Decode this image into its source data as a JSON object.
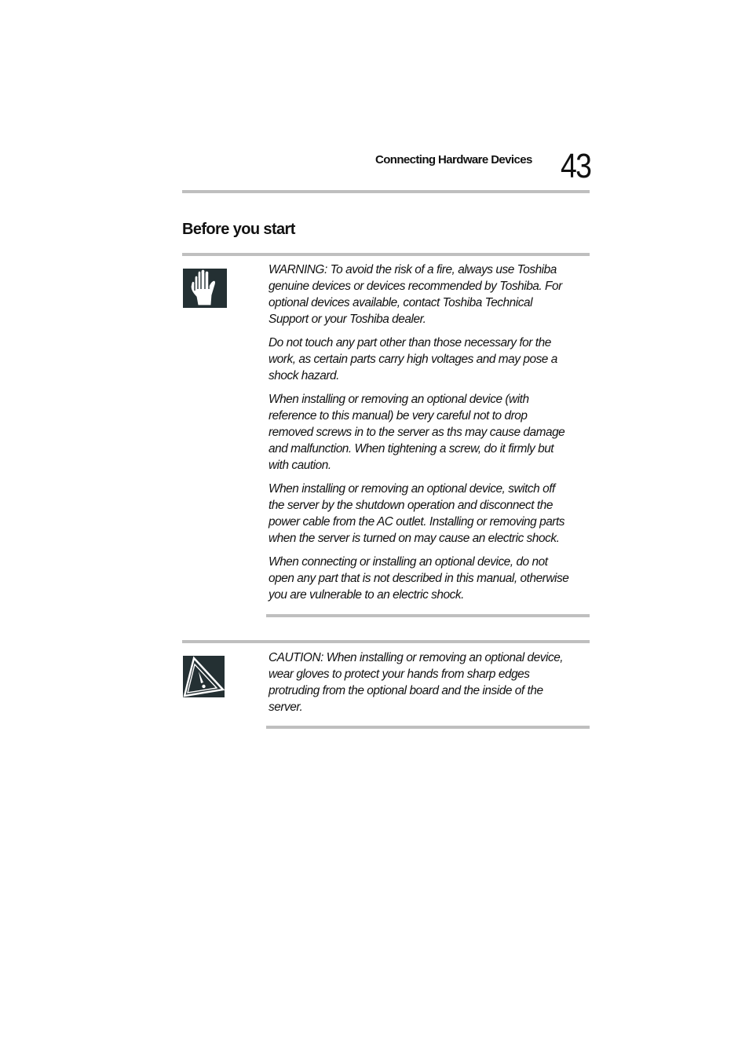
{
  "header": {
    "running_title": "Connecting Hardware Devices",
    "page_number": "43"
  },
  "section": {
    "title": "Before you start"
  },
  "warning_note": {
    "icon": "hand-stop-icon",
    "paragraphs": [
      "WARNING: To avoid the risk of a fire, always use Toshiba genuine devices or devices recommended by Toshiba. For optional devices available, contact Toshiba Technical Support or your Toshiba dealer.",
      "Do not touch any part other than those necessary for the work, as certain parts carry high voltages and may pose a shock hazard.",
      "When installing or removing an optional device (with reference to this manual) be very careful not to drop removed screws in to the server as ths may cause damage and malfunction. When tightening a screw, do it firmly but with caution.",
      "When installing or removing an optional device, switch off the server by the shutdown operation and disconnect the power cable from the AC outlet. Installing or removing parts when the server is turned on may cause an electric shock.",
      "When connecting or installing an optional device, do not open any part that is not described in this manual, otherwise you are vulnerable to an electric shock."
    ]
  },
  "caution_note": {
    "icon": "warning-triangle-icon",
    "paragraphs": [
      "CAUTION: When installing or removing an optional device, wear gloves to protect your hands from sharp edges protruding from the optional board and the inside of the server."
    ]
  }
}
